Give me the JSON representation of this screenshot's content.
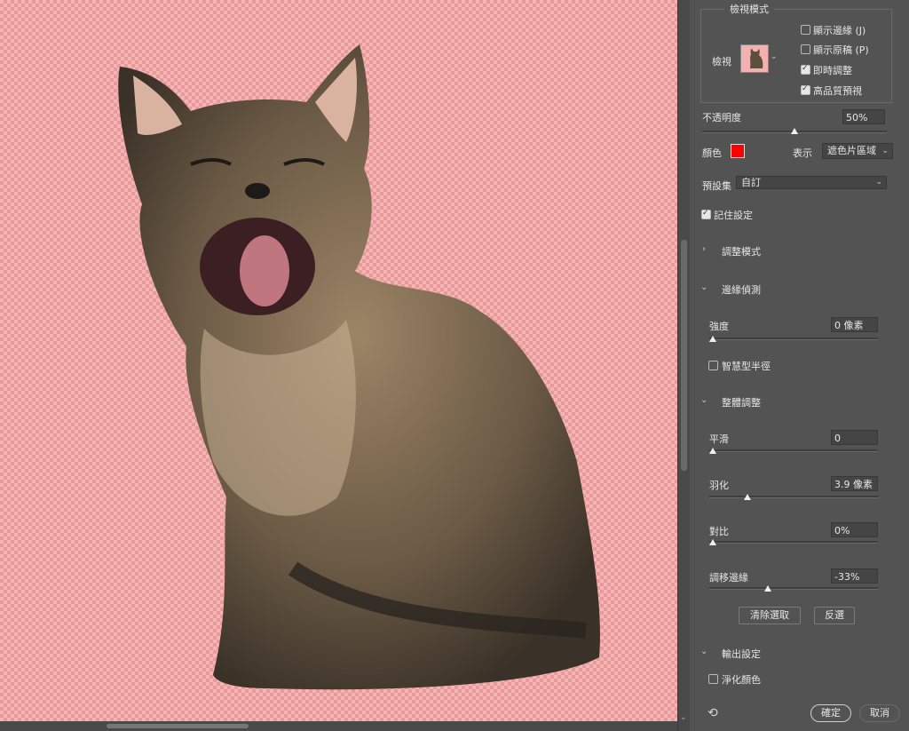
{
  "view_mode": {
    "legend": "檢視模式",
    "view_label": "檢視",
    "thumb_icon": "cat-thumbnail-icon",
    "options": [
      {
        "label": "顯示邊緣 (J)",
        "checked": false
      },
      {
        "label": "顯示原稿 (P)",
        "checked": false
      },
      {
        "label": "即時調整",
        "checked": true
      },
      {
        "label": "高品質預視",
        "checked": true
      }
    ]
  },
  "opacity": {
    "label": "不透明度",
    "value": "50%",
    "level": 0.5
  },
  "color": {
    "label": "顏色",
    "swatch": "#ff0000"
  },
  "display": {
    "label": "表示",
    "value": "遮色片區域"
  },
  "preset": {
    "label": "預設集",
    "value": "自訂"
  },
  "remember": {
    "label": "記住設定",
    "checked": true
  },
  "sections": {
    "adjust_mode": "調整模式",
    "edge_detection": "邊緣偵測",
    "global_refine": "整體調整",
    "output": "輸出設定"
  },
  "radius": {
    "label": "強度",
    "value": "0 像素",
    "level": 0
  },
  "smart_radius": {
    "label": "智慧型半徑",
    "checked": false
  },
  "smooth": {
    "label": "平滑",
    "value": "0",
    "level": 0
  },
  "feather": {
    "label": "羽化",
    "value": "3.9 像素",
    "level": 0.2
  },
  "contrast": {
    "label": "對比",
    "value": "0%",
    "level": 0
  },
  "shift_edge": {
    "label": "調移邊緣",
    "value": "-33%",
    "level": 0.33
  },
  "buttons": {
    "clear": "清除選取",
    "invert": "反選",
    "ok": "確定",
    "cancel": "取消"
  },
  "decontaminate": {
    "label": "淨化顏色",
    "checked": false
  },
  "colors": {
    "canvas_bg": "#f6b5b5",
    "panel_bg": "#535353",
    "swatch": "#ff0000"
  }
}
